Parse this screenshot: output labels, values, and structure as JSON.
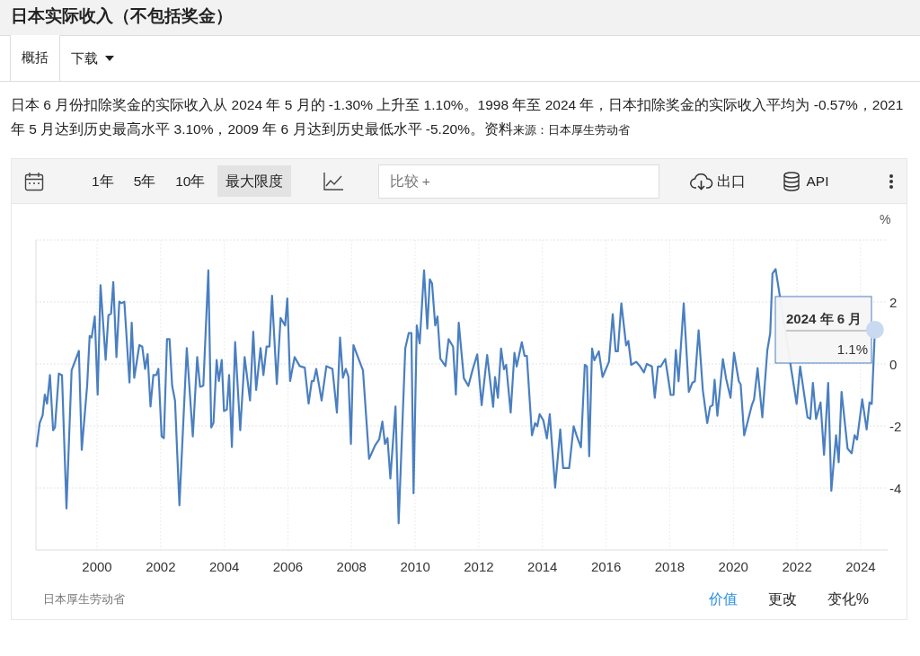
{
  "page_title": "日本实际收入（不包括奖金）",
  "tabs": [
    {
      "label": "概括",
      "selected": true,
      "kind": "tab"
    },
    {
      "label": "下载",
      "selected": false,
      "kind": "dropdown"
    }
  ],
  "description": {
    "text": "日本 6 月份扣除奖金的实际收入从 2024 年 5 月的 -1.30% 上升至 1.10%。1998 年至 2024 年，日本扣除奖金的实际收入平均为 -0.57%，2021 年 5 月达到历史最高水平 3.10%，2009 年 6 月达到历史最低水平 -5.20%。资料",
    "source": "来源：日本厚生劳动省"
  },
  "toolbar": {
    "ranges": [
      {
        "label": "1年",
        "selected": false
      },
      {
        "label": "5年",
        "selected": false
      },
      {
        "label": "10年",
        "selected": false
      },
      {
        "label": "最大限度",
        "selected": true
      }
    ],
    "compare_placeholder": "比较 +",
    "export_label": "出口",
    "api_label": "API"
  },
  "chart": {
    "tooltip": {
      "date": "2024 年 6 月",
      "value": "1.1%"
    },
    "chart_data": {
      "type": "line",
      "ylabel": "%",
      "grid": true,
      "xlim": [
        1998.08,
        2024.85
      ],
      "ylim": [
        -6,
        4
      ],
      "xticks": [
        2000,
        2002,
        2004,
        2006,
        2008,
        2010,
        2012,
        2014,
        2016,
        2018,
        2020,
        2022,
        2024
      ],
      "yticks": [
        -4,
        -2,
        0,
        2
      ],
      "x": [
        1998.1,
        1998.2,
        1998.29,
        1998.36,
        1998.43,
        1998.52,
        1998.62,
        1998.68,
        1998.8,
        1998.9,
        1999.04,
        1999.2,
        1999.43,
        1999.52,
        1999.69,
        1999.77,
        1999.83,
        1999.93,
        2000.02,
        2000.11,
        2000.27,
        2000.36,
        2000.44,
        2000.51,
        2000.61,
        2000.7,
        2000.77,
        2000.86,
        2001.02,
        2001.09,
        2001.17,
        2001.33,
        2001.42,
        2001.51,
        2001.59,
        2001.68,
        2001.77,
        2001.86,
        2001.93,
        2002.03,
        2002.1,
        2002.2,
        2002.28,
        2002.36,
        2002.45,
        2002.59,
        2002.82,
        2003.01,
        2003.15,
        2003.24,
        2003.34,
        2003.5,
        2003.59,
        2003.66,
        2003.76,
        2003.83,
        2003.92,
        2003.99,
        2004.08,
        2004.15,
        2004.24,
        2004.34,
        2004.5,
        2004.64,
        2004.81,
        2004.91,
        2005.0,
        2005.14,
        2005.23,
        2005.33,
        2005.42,
        2005.5,
        2005.65,
        2005.77,
        2005.91,
        2005.98,
        2006.07,
        2006.21,
        2006.37,
        2006.53,
        2006.65,
        2006.75,
        2006.81,
        2006.89,
        2007.06,
        2007.21,
        2007.4,
        2007.54,
        2007.64,
        2007.73,
        2007.82,
        2007.9,
        2007.98,
        2008.06,
        2008.18,
        2008.36,
        2008.55,
        2008.74,
        2008.87,
        2008.97,
        2009.05,
        2009.13,
        2009.22,
        2009.38,
        2009.48,
        2009.69,
        2009.8,
        2009.88,
        2009.95,
        2010.05,
        2010.14,
        2010.28,
        2010.38,
        2010.46,
        2010.53,
        2010.63,
        2010.7,
        2010.79,
        2010.95,
        2011.05,
        2011.19,
        2011.28,
        2011.37,
        2011.53,
        2011.67,
        2011.81,
        2011.95,
        2012.09,
        2012.26,
        2012.45,
        2012.51,
        2012.6,
        2012.7,
        2012.79,
        2012.86,
        2013.0,
        2013.12,
        2013.19,
        2013.35,
        2013.44,
        2013.51,
        2013.67,
        2013.77,
        2013.84,
        2013.91,
        2014.03,
        2014.14,
        2014.23,
        2014.4,
        2014.56,
        2014.65,
        2014.84,
        2014.98,
        2015.07,
        2015.21,
        2015.33,
        2015.4,
        2015.47,
        2015.56,
        2015.63,
        2015.77,
        2015.89,
        2016.09,
        2016.21,
        2016.3,
        2016.37,
        2016.48,
        2016.63,
        2016.7,
        2016.79,
        2016.95,
        2017.07,
        2017.19,
        2017.28,
        2017.44,
        2017.53,
        2017.63,
        2017.72,
        2017.86,
        2018.03,
        2018.12,
        2018.19,
        2018.28,
        2018.44,
        2018.6,
        2018.71,
        2018.79,
        2018.91,
        2019.04,
        2019.18,
        2019.27,
        2019.35,
        2019.41,
        2019.5,
        2019.67,
        2019.77,
        2019.91,
        2020.02,
        2020.17,
        2020.23,
        2020.34,
        2020.58,
        2020.65,
        2020.76,
        2020.91,
        2021.07,
        2021.16,
        2021.23,
        2021.33,
        2021.99,
        2022.1,
        2022.33,
        2022.42,
        2022.5,
        2022.6,
        2022.74,
        2022.85,
        2022.98,
        2023.08,
        2023.23,
        2023.31,
        2023.4,
        2023.59,
        2023.72,
        2023.81,
        2023.89,
        2024.05,
        2024.19,
        2024.28,
        2024.35,
        2024.45
      ],
      "series": [
        {
          "color": "#4a7fc1",
          "values": [
            -2.68,
            -1.9,
            -1.66,
            -0.99,
            -1.28,
            -0.36,
            -2.14,
            -2.05,
            -0.31,
            -0.36,
            -4.66,
            -0.21,
            0.42,
            -2.77,
            -0.7,
            0.9,
            0.85,
            1.53,
            -0.99,
            2.54,
            0.13,
            1.57,
            1.62,
            2.64,
            0.22,
            2.01,
            1.96,
            2.01,
            -0.6,
            1.33,
            -0.45,
            0.61,
            0.56,
            -0.16,
            0.32,
            -1.37,
            -0.36,
            -0.36,
            -0.16,
            -2.34,
            -2.39,
            0.8,
            0.8,
            -0.7,
            -1.18,
            -4.56,
            0.51,
            -2.34,
            0.22,
            -0.74,
            -0.7,
            3.02,
            -2.05,
            -1.9,
            0.13,
            -0.55,
            0.13,
            -1.52,
            -1.47,
            -0.36,
            -2.68,
            0.71,
            -2.14,
            0.22,
            -1.18,
            1.04,
            -0.84,
            0.51,
            -0.36,
            0.56,
            0.56,
            2.2,
            -0.65,
            1.48,
            1.24,
            2.11,
            -0.55,
            0.22,
            -0.07,
            -0.12,
            -1.28,
            -0.55,
            -0.55,
            -0.16,
            -1.18,
            -0.07,
            -0.16,
            -1.57,
            0.85,
            -0.45,
            -0.16,
            -0.41,
            -2.58,
            0.61,
            0.27,
            -0.21,
            -3.06,
            -2.63,
            -2.43,
            -1.86,
            -2.58,
            -2.39,
            -3.69,
            -1.37,
            -5.14,
            0.51,
            1.0,
            1.0,
            -4.17,
            1.24,
            0.66,
            3.02,
            1.14,
            2.73,
            2.59,
            1.24,
            1.53,
            0.17,
            -0.07,
            0.8,
            0.56,
            -0.99,
            1.33,
            -0.46,
            -0.71,
            -0.17,
            0.31,
            -1.33,
            0.29,
            -1.38,
            -0.42,
            -1.09,
            0.5,
            -0.17,
            -0.03,
            -1.57,
            0.36,
            -0.08,
            0.7,
            0.26,
            0.26,
            -2.3,
            -1.91,
            -2.01,
            -1.62,
            -1.82,
            -2.4,
            -1.62,
            -3.99,
            -2.11,
            -3.36,
            -3.36,
            -2.01,
            -2.3,
            -2.69,
            -0.03,
            -0.08,
            -2.98,
            0.5,
            0.12,
            0.41,
            -0.42,
            0.07,
            1.61,
            0.41,
            0.41,
            1.95,
            0.6,
            0.74,
            -0.03,
            0.07,
            -0.08,
            -0.27,
            0.0,
            -0.08,
            -1.09,
            -0.08,
            -0.08,
            0.16,
            -1.0,
            -1.0,
            0.45,
            -0.56,
            1.95,
            -0.9,
            -0.61,
            -0.56,
            1.08,
            -0.85,
            -1.91,
            -1.38,
            -1.33,
            -0.51,
            -1.67,
            0.16,
            -0.46,
            -1.09,
            0.36,
            -0.56,
            -0.66,
            -2.3,
            -1.33,
            -1.14,
            -0.13,
            -1.72,
            0.45,
            0.99,
            2.92,
            3.06,
            -1.29,
            -0.08,
            -1.72,
            -1.77,
            -0.61,
            -1.77,
            -1.24,
            -2.93,
            -0.61,
            -4.09,
            -2.3,
            -3.17,
            -0.9,
            -2.73,
            -2.88,
            -2.3,
            -2.44,
            -1.14,
            -2.11,
            -1.24,
            -1.29,
            1.1
          ]
        }
      ]
    }
  },
  "footer": {
    "source": "日本厚生劳动省",
    "views": [
      {
        "label": "价值",
        "selected": true
      },
      {
        "label": "更改",
        "selected": false
      },
      {
        "label": "变化%",
        "selected": false
      }
    ]
  }
}
